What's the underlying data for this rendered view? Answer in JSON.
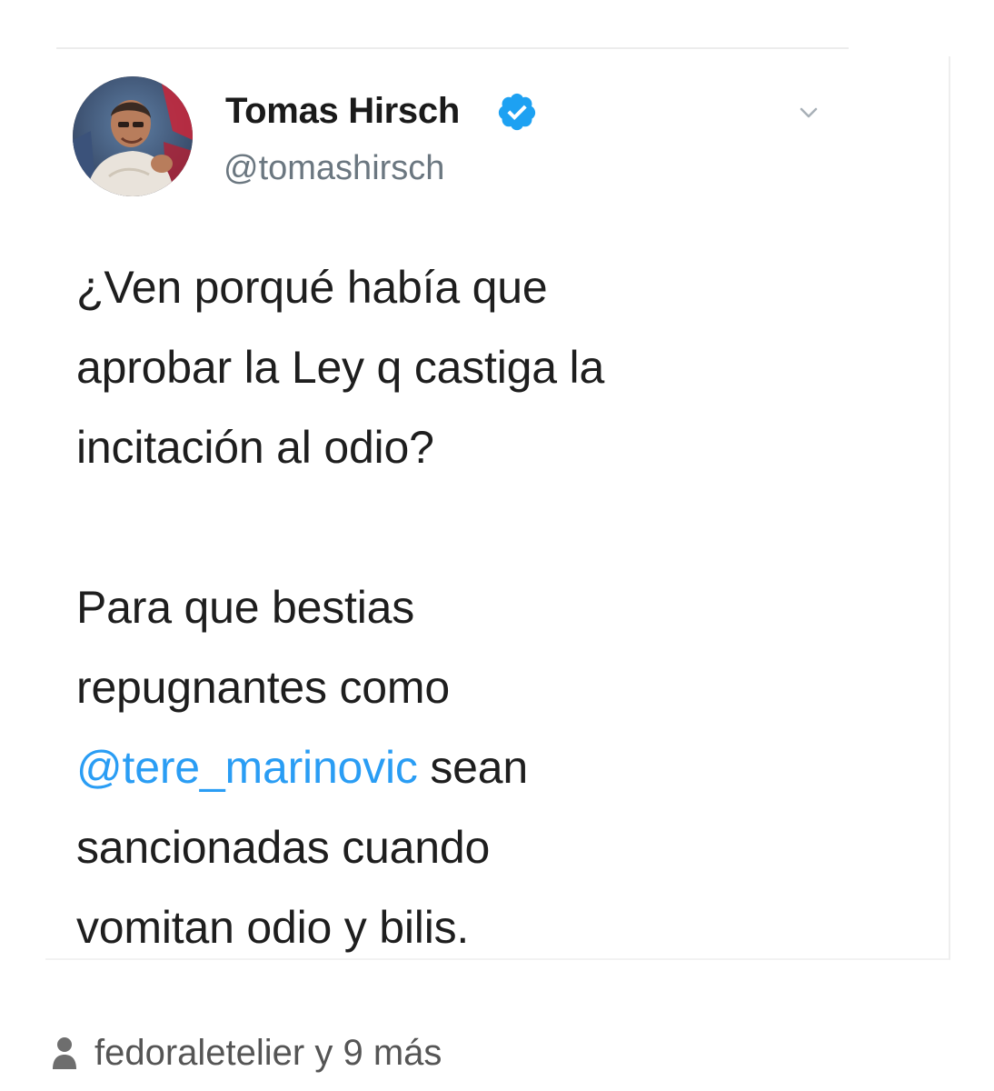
{
  "tweet": {
    "author_name": "Tomas Hirsch",
    "handle": "@tomashirsch",
    "icons": {
      "avatar": "profile-photo",
      "verified": "verified-badge-icon",
      "menu": "chevron-down-icon"
    },
    "body": {
      "line1": "¿Ven porqué había que",
      "line2": "aprobar la Ley q castiga la",
      "line3": "incitación al odio?",
      "line4": "Para que bestias",
      "line5": "repugnantes como",
      "mention": "@tere_marinovic",
      "line6_rest": " sean",
      "line7": "sancionadas cuando",
      "line8": "vomitan odio y bilis."
    },
    "colors": {
      "mention": "#2a9df4",
      "verified": "#1da1f2"
    }
  },
  "footer": {
    "icon": "person-icon",
    "text": "fedoraletelier y 9 más"
  }
}
